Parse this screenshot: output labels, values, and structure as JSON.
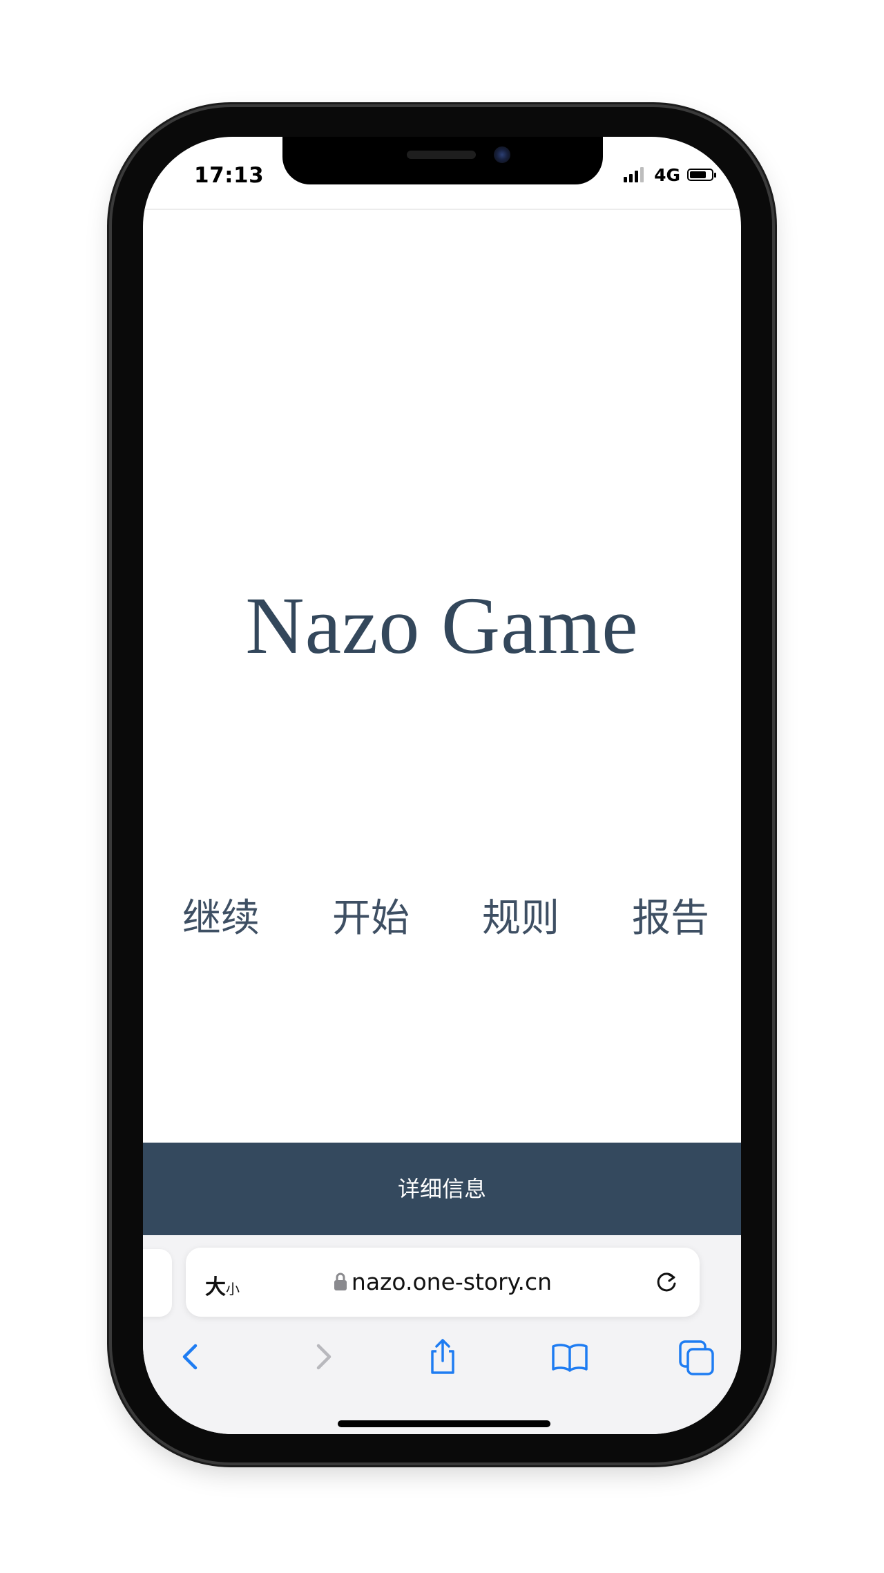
{
  "status_bar": {
    "time": "17:13",
    "network": "4G"
  },
  "page": {
    "title": "Nazo Game",
    "menu": [
      "继续",
      "开始",
      "规则",
      "报告"
    ],
    "details_label": "详细信息"
  },
  "browser": {
    "text_size_big": "大",
    "text_size_small": "小",
    "url": "nazo.one-story.cn"
  },
  "colors": {
    "title": "#33475b",
    "details_bar": "#34495e",
    "ios_blue": "#1e7cf2"
  },
  "icons": [
    "signal-icon",
    "battery-icon",
    "lock-icon",
    "reload-icon",
    "back-icon",
    "forward-icon",
    "share-icon",
    "bookmarks-icon",
    "tabs-icon"
  ]
}
